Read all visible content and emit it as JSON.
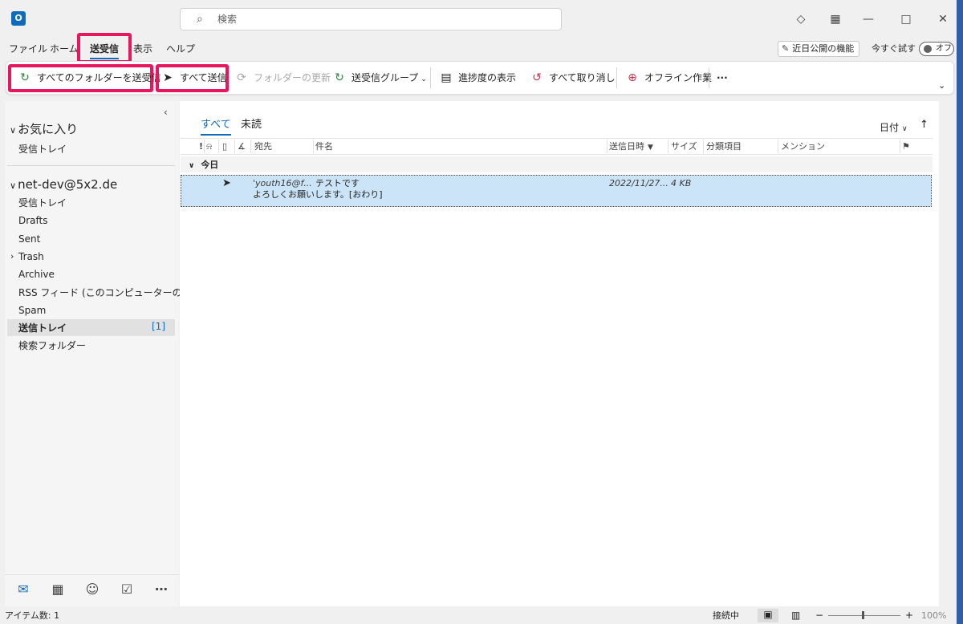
{
  "titlebar": {
    "app_icon": "outlook-logo",
    "search_placeholder": "検索",
    "icons": [
      "diamond-icon",
      "qr-icon",
      "minimize-icon",
      "maximize-icon",
      "close-icon"
    ]
  },
  "menu": {
    "tabs": [
      "ファイル",
      "ホーム",
      "送受信",
      "表示",
      "ヘルプ"
    ],
    "active": "送受信",
    "feature_button": "近日公開の機能",
    "try_now": "今すぐ試す",
    "toggle_label": "オフ"
  },
  "ribbon": {
    "send_receive_all": "すべてのフォルダーを送受信",
    "send_all": "すべて送信",
    "update_folder": "フォルダーの更新",
    "send_receive_groups": "送受信グループ",
    "show_progress": "進捗度の表示",
    "cancel_all": "すべて取り消し",
    "work_offline": "オフライン作業",
    "more": "···"
  },
  "sidebar": {
    "favorites": "お気に入り",
    "favorites_items": [
      "受信トレイ"
    ],
    "account": "net-dev@5x2.de",
    "folders": [
      "受信トレイ",
      "Drafts",
      "Sent",
      "Trash",
      "Archive",
      "RSS フィード (このコンピューターのみ)",
      "Spam",
      "送信トレイ",
      "検索フォルダー"
    ],
    "selected": "送信トレイ",
    "selected_count": "[1]"
  },
  "message_list": {
    "filter_tabs": [
      "すべて",
      "未読"
    ],
    "sort_label": "日付",
    "columns": {
      "importance": "!",
      "to": "宛先",
      "subject": "件名",
      "sent": "送信日時",
      "size": "サイズ",
      "category": "分類項目",
      "mention": "メンション"
    },
    "group_label": "今日",
    "messages": [
      {
        "to": "'youth16@f...",
        "subject": "テストです",
        "preview": "よろしくお願いします。[おわり]",
        "sent": "2022/11/27...",
        "size": "4 KB"
      }
    ]
  },
  "statusbar": {
    "item_count": "アイテム数: 1",
    "connection": "接続中",
    "zoom": "100%"
  },
  "colors": {
    "accent": "#0f6cbd",
    "highlight": "#e8175d",
    "selected_row": "#cce4f7"
  }
}
